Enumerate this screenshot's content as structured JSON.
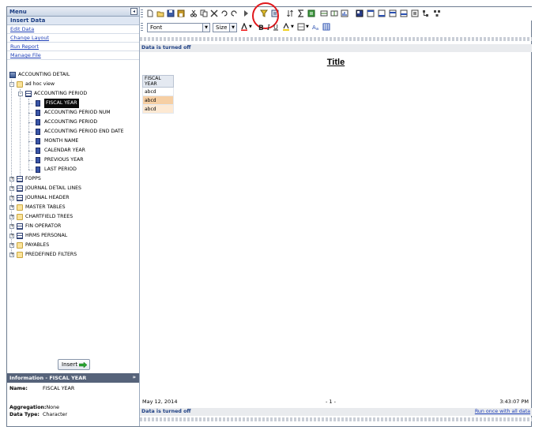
{
  "menu": {
    "title": "Menu",
    "selected": "Insert Data",
    "links": [
      "Edit Data",
      "Change Layout",
      "Run Report",
      "Manage File"
    ]
  },
  "tree": [
    {
      "label": "ACCOUNTING DETAIL",
      "level": 0,
      "icon": "db-icon"
    },
    {
      "label": "ad hoc view",
      "level": 1,
      "icon": "folder-icon",
      "toggle": "-"
    },
    {
      "label": "ACCOUNTING PERIOD",
      "level": 2,
      "icon": "table-icon",
      "toggle": "-"
    },
    {
      "label": "FISCAL YEAR",
      "level": 3,
      "icon": "field-icon",
      "highlight": true
    },
    {
      "label": "ACCOUNTING PERIOD NUM",
      "level": 3,
      "icon": "field-icon"
    },
    {
      "label": "ACCOUNTING PERIOD",
      "level": 3,
      "icon": "field-icon"
    },
    {
      "label": "ACCOUNTING PERIOD END DATE",
      "level": 3,
      "icon": "field-icon"
    },
    {
      "label": "MONTH NAME",
      "level": 3,
      "icon": "field-icon"
    },
    {
      "label": "CALENDAR YEAR",
      "level": 3,
      "icon": "field-icon"
    },
    {
      "label": "PREVIOUS YEAR",
      "level": 3,
      "icon": "field-icon"
    },
    {
      "label": "LAST PERIOD",
      "level": 3,
      "icon": "field-icon"
    },
    {
      "label": "FOPPS",
      "level": 1,
      "icon": "table-icon",
      "toggle": "+"
    },
    {
      "label": "JOURNAL DETAIL LINES",
      "level": 1,
      "icon": "table-icon",
      "toggle": "+"
    },
    {
      "label": "JOURNAL HEADER",
      "level": 1,
      "icon": "table-icon",
      "toggle": "+"
    },
    {
      "label": "MASTER TABLES",
      "level": 1,
      "icon": "folder-icon",
      "toggle": "+"
    },
    {
      "label": "CHARTFIELD TREES",
      "level": 1,
      "icon": "folder-icon",
      "toggle": "+"
    },
    {
      "label": "FIN OPERATOR",
      "level": 1,
      "icon": "table-icon",
      "toggle": "+"
    },
    {
      "label": "HRMS PERSONAL",
      "level": 1,
      "icon": "table-icon",
      "toggle": "+"
    },
    {
      "label": "PAYABLES",
      "level": 1,
      "icon": "folder-icon",
      "toggle": "+"
    },
    {
      "label": "PREDEFINED FILTERS",
      "level": 1,
      "icon": "folder-icon",
      "toggle": "+"
    }
  ],
  "insert_label": "Insert",
  "info": {
    "header": "Information - FISCAL YEAR",
    "name_label": "Name:",
    "name_value": "FISCAL YEAR",
    "aggregation_label": "Aggregation:",
    "aggregation_value": "None",
    "datatype_label": "Data Type:",
    "datatype_value": "Character"
  },
  "format": {
    "font_value": "Font",
    "size_value": "Size"
  },
  "report": {
    "status": "Data is turned off",
    "title": "Title",
    "column_header": "FISCAL YEAR",
    "rows": [
      "abcd",
      "abcd",
      "abcd"
    ],
    "footer_date": "May 12, 2014",
    "footer_page": "- 1 -",
    "footer_time": "3:43:07 PM",
    "footer_status": "Data is turned off",
    "run_link": "Run once with all data"
  },
  "colors": {
    "highlight_circle": "#e0181c",
    "accent": "#1b3d82"
  }
}
